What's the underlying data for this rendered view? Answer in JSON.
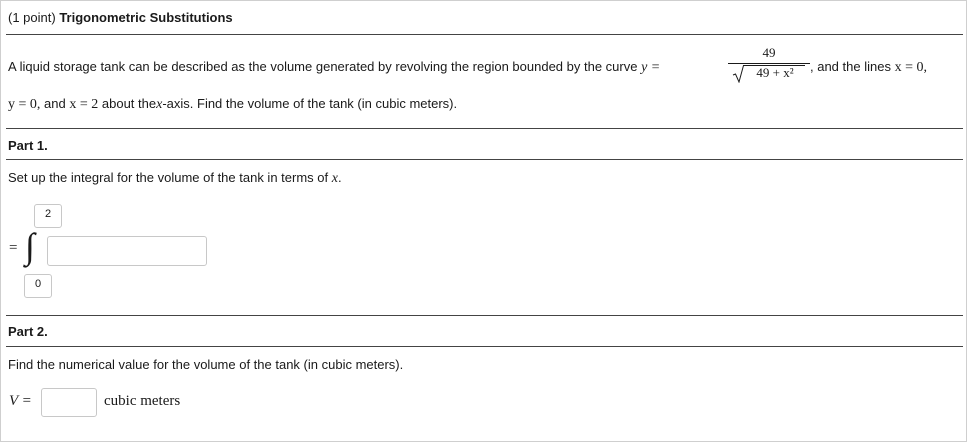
{
  "header": {
    "points": "(1 point)",
    "title": "Trigonometric Substitutions"
  },
  "problem": {
    "text1": "A liquid storage tank can be described as the volume generated by revolving the region bounded by the curve",
    "y_eq": "y =",
    "numerator": "49",
    "denominator": "49 + x²",
    "text2": ", and the lines",
    "x_eq0": "x = 0,",
    "line2_y0": "y = 0,",
    "and": "and",
    "x_eq2": "x = 2",
    "text3a": "about the",
    "xvar": "x",
    "text3b": "-axis. Find the volume of the tank (in cubic meters)."
  },
  "part1": {
    "title": "Part 1.",
    "instruction": "Set up the integral for the volume of the tank in terms of",
    "instruction_var": "x",
    "instruction_end": ".",
    "equals": "=",
    "integral_sign": "∫",
    "upper_limit": "2",
    "lower_limit": "0",
    "integrand_value": ""
  },
  "part2": {
    "title": "Part 2.",
    "instruction": "Find the numerical value for the volume of the tank (in cubic meters).",
    "v_label": "V =",
    "v_value": "",
    "units": "cubic meters"
  }
}
